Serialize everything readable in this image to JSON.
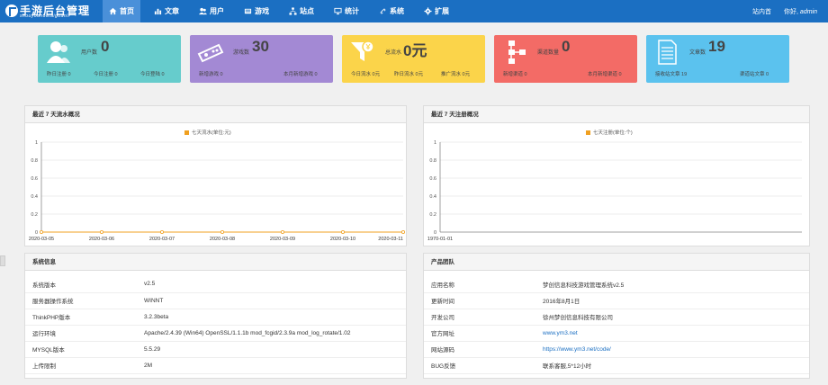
{
  "header": {
    "logo_title": "手游后台管理",
    "logo_sub": "shouyouhoutaiguanli",
    "nav": [
      {
        "label": "首页",
        "icon": "home-icon",
        "active": true
      },
      {
        "label": "文章",
        "icon": "bar-chart-icon",
        "active": false
      },
      {
        "label": "用户",
        "icon": "users-icon",
        "active": false
      },
      {
        "label": "游戏",
        "icon": "game-icon",
        "active": false
      },
      {
        "label": "站点",
        "icon": "sitemap-icon",
        "active": false
      },
      {
        "label": "统计",
        "icon": "monitor-icon",
        "active": false
      },
      {
        "label": "系统",
        "icon": "link-icon",
        "active": false
      },
      {
        "label": "扩展",
        "icon": "gear-icon",
        "active": false
      }
    ],
    "site_home": "站内首",
    "greeting": "你好,",
    "username": "admin"
  },
  "cards": [
    {
      "label": "用户数",
      "value": "0",
      "f1": "昨日注册 0",
      "f2": "今日注册 0",
      "f3": "今日登陆 0",
      "color": "#66cccc",
      "icon": "user-icon"
    },
    {
      "label": "游戏数",
      "value": "30",
      "f1": "新增游戏 0",
      "f2": "本月新增游戏 0",
      "color": "#a389d4",
      "icon": "gamepad-icon"
    },
    {
      "label": "总流水",
      "value": "0元",
      "f1": "今日流水 0元",
      "f2": "昨日流水 0元",
      "f3": "推广流水 0元",
      "color": "#fbd44a",
      "icon": "funnel-icon"
    },
    {
      "label": "渠道数量",
      "value": "0",
      "f1": "新增渠道 0",
      "f2": "本月新增渠道 0",
      "color": "#f36b66",
      "icon": "channel-tree-icon"
    },
    {
      "label": "文章数",
      "value": "19",
      "f1": "接收站文章 19",
      "f2": "渠道站文章 0",
      "color": "#5bc2ee",
      "icon": "document-icon"
    }
  ],
  "panels": {
    "flow_title": "最近 7 天流水概况",
    "reg_title": "最近 7 天注册概况",
    "sys_title": "系统信息",
    "team_title": "产品团队"
  },
  "chart_data": [
    {
      "type": "line",
      "title": "",
      "legend": "七天流水(单位:元)",
      "x": [
        "2020-03-05",
        "2020-03-06",
        "2020-03-07",
        "2020-03-08",
        "2020-03-09",
        "2020-03-10",
        "2020-03-11"
      ],
      "series": [
        {
          "name": "七天流水(单位:元)",
          "values": [
            0,
            0,
            0,
            0,
            0,
            0,
            0
          ]
        }
      ],
      "y_ticks": [
        "0",
        "0.2",
        "0.4",
        "0.6",
        "0.8",
        "1"
      ],
      "ylim": [
        0,
        1
      ],
      "color": "#f0a020",
      "grid": true
    },
    {
      "type": "line",
      "title": "",
      "legend": "七天注册(单位:个)",
      "x": [
        "1970-01-01"
      ],
      "series": [
        {
          "name": "七天注册(单位:个)",
          "values": []
        }
      ],
      "y_ticks": [
        "0",
        "0.2",
        "0.4",
        "0.6",
        "0.8",
        "1"
      ],
      "ylim": [
        0,
        1
      ],
      "color": "#f0a020",
      "grid": true
    }
  ],
  "system_info": [
    {
      "k": "系统版本",
      "v": "v2.5"
    },
    {
      "k": "服务器操作系统",
      "v": "WINNT"
    },
    {
      "k": "ThinkPHP版本",
      "v": "3.2.3beta"
    },
    {
      "k": "运行环境",
      "v": "Apache/2.4.39 (Win64) OpenSSL/1.1.1b mod_fcgid/2.3.9a mod_log_rotate/1.02"
    },
    {
      "k": "MYSQL版本",
      "v": "5.5.29"
    },
    {
      "k": "上传限制",
      "v": "2M"
    }
  ],
  "team_info": [
    {
      "k": "应用名称",
      "v": "梦创信息科技游戏管理系统v2.5"
    },
    {
      "k": "更新时间",
      "v": "2016年8月1日"
    },
    {
      "k": "开发公司",
      "v": "徐州梦创信息科技有限公司"
    },
    {
      "k": "官方网址",
      "v": "www.ym3.net",
      "link": true
    },
    {
      "k": "网站源码",
      "v": "https://www.ym3.net/code/",
      "link": true
    },
    {
      "k": "BUG反馈",
      "v": "联系客服,5*12小时"
    }
  ]
}
